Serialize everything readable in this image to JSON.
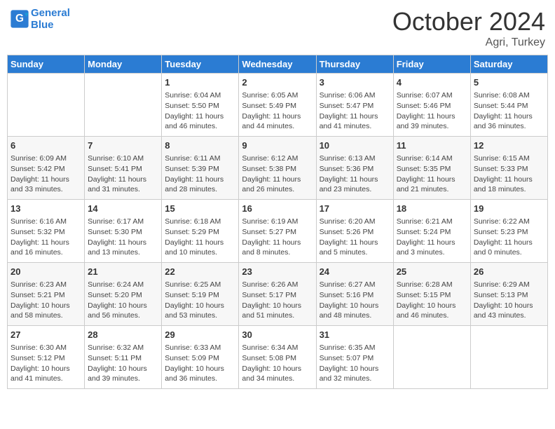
{
  "header": {
    "logo_line1": "General",
    "logo_line2": "Blue",
    "month_title": "October 2024",
    "subtitle": "Agri, Turkey"
  },
  "days_of_week": [
    "Sunday",
    "Monday",
    "Tuesday",
    "Wednesday",
    "Thursday",
    "Friday",
    "Saturday"
  ],
  "weeks": [
    [
      {
        "day": "",
        "info": ""
      },
      {
        "day": "",
        "info": ""
      },
      {
        "day": "1",
        "info": "Sunrise: 6:04 AM\nSunset: 5:50 PM\nDaylight: 11 hours and 46 minutes."
      },
      {
        "day": "2",
        "info": "Sunrise: 6:05 AM\nSunset: 5:49 PM\nDaylight: 11 hours and 44 minutes."
      },
      {
        "day": "3",
        "info": "Sunrise: 6:06 AM\nSunset: 5:47 PM\nDaylight: 11 hours and 41 minutes."
      },
      {
        "day": "4",
        "info": "Sunrise: 6:07 AM\nSunset: 5:46 PM\nDaylight: 11 hours and 39 minutes."
      },
      {
        "day": "5",
        "info": "Sunrise: 6:08 AM\nSunset: 5:44 PM\nDaylight: 11 hours and 36 minutes."
      }
    ],
    [
      {
        "day": "6",
        "info": "Sunrise: 6:09 AM\nSunset: 5:42 PM\nDaylight: 11 hours and 33 minutes."
      },
      {
        "day": "7",
        "info": "Sunrise: 6:10 AM\nSunset: 5:41 PM\nDaylight: 11 hours and 31 minutes."
      },
      {
        "day": "8",
        "info": "Sunrise: 6:11 AM\nSunset: 5:39 PM\nDaylight: 11 hours and 28 minutes."
      },
      {
        "day": "9",
        "info": "Sunrise: 6:12 AM\nSunset: 5:38 PM\nDaylight: 11 hours and 26 minutes."
      },
      {
        "day": "10",
        "info": "Sunrise: 6:13 AM\nSunset: 5:36 PM\nDaylight: 11 hours and 23 minutes."
      },
      {
        "day": "11",
        "info": "Sunrise: 6:14 AM\nSunset: 5:35 PM\nDaylight: 11 hours and 21 minutes."
      },
      {
        "day": "12",
        "info": "Sunrise: 6:15 AM\nSunset: 5:33 PM\nDaylight: 11 hours and 18 minutes."
      }
    ],
    [
      {
        "day": "13",
        "info": "Sunrise: 6:16 AM\nSunset: 5:32 PM\nDaylight: 11 hours and 16 minutes."
      },
      {
        "day": "14",
        "info": "Sunrise: 6:17 AM\nSunset: 5:30 PM\nDaylight: 11 hours and 13 minutes."
      },
      {
        "day": "15",
        "info": "Sunrise: 6:18 AM\nSunset: 5:29 PM\nDaylight: 11 hours and 10 minutes."
      },
      {
        "day": "16",
        "info": "Sunrise: 6:19 AM\nSunset: 5:27 PM\nDaylight: 11 hours and 8 minutes."
      },
      {
        "day": "17",
        "info": "Sunrise: 6:20 AM\nSunset: 5:26 PM\nDaylight: 11 hours and 5 minutes."
      },
      {
        "day": "18",
        "info": "Sunrise: 6:21 AM\nSunset: 5:24 PM\nDaylight: 11 hours and 3 minutes."
      },
      {
        "day": "19",
        "info": "Sunrise: 6:22 AM\nSunset: 5:23 PM\nDaylight: 11 hours and 0 minutes."
      }
    ],
    [
      {
        "day": "20",
        "info": "Sunrise: 6:23 AM\nSunset: 5:21 PM\nDaylight: 10 hours and 58 minutes."
      },
      {
        "day": "21",
        "info": "Sunrise: 6:24 AM\nSunset: 5:20 PM\nDaylight: 10 hours and 56 minutes."
      },
      {
        "day": "22",
        "info": "Sunrise: 6:25 AM\nSunset: 5:19 PM\nDaylight: 10 hours and 53 minutes."
      },
      {
        "day": "23",
        "info": "Sunrise: 6:26 AM\nSunset: 5:17 PM\nDaylight: 10 hours and 51 minutes."
      },
      {
        "day": "24",
        "info": "Sunrise: 6:27 AM\nSunset: 5:16 PM\nDaylight: 10 hours and 48 minutes."
      },
      {
        "day": "25",
        "info": "Sunrise: 6:28 AM\nSunset: 5:15 PM\nDaylight: 10 hours and 46 minutes."
      },
      {
        "day": "26",
        "info": "Sunrise: 6:29 AM\nSunset: 5:13 PM\nDaylight: 10 hours and 43 minutes."
      }
    ],
    [
      {
        "day": "27",
        "info": "Sunrise: 6:30 AM\nSunset: 5:12 PM\nDaylight: 10 hours and 41 minutes."
      },
      {
        "day": "28",
        "info": "Sunrise: 6:32 AM\nSunset: 5:11 PM\nDaylight: 10 hours and 39 minutes."
      },
      {
        "day": "29",
        "info": "Sunrise: 6:33 AM\nSunset: 5:09 PM\nDaylight: 10 hours and 36 minutes."
      },
      {
        "day": "30",
        "info": "Sunrise: 6:34 AM\nSunset: 5:08 PM\nDaylight: 10 hours and 34 minutes."
      },
      {
        "day": "31",
        "info": "Sunrise: 6:35 AM\nSunset: 5:07 PM\nDaylight: 10 hours and 32 minutes."
      },
      {
        "day": "",
        "info": ""
      },
      {
        "day": "",
        "info": ""
      }
    ]
  ]
}
